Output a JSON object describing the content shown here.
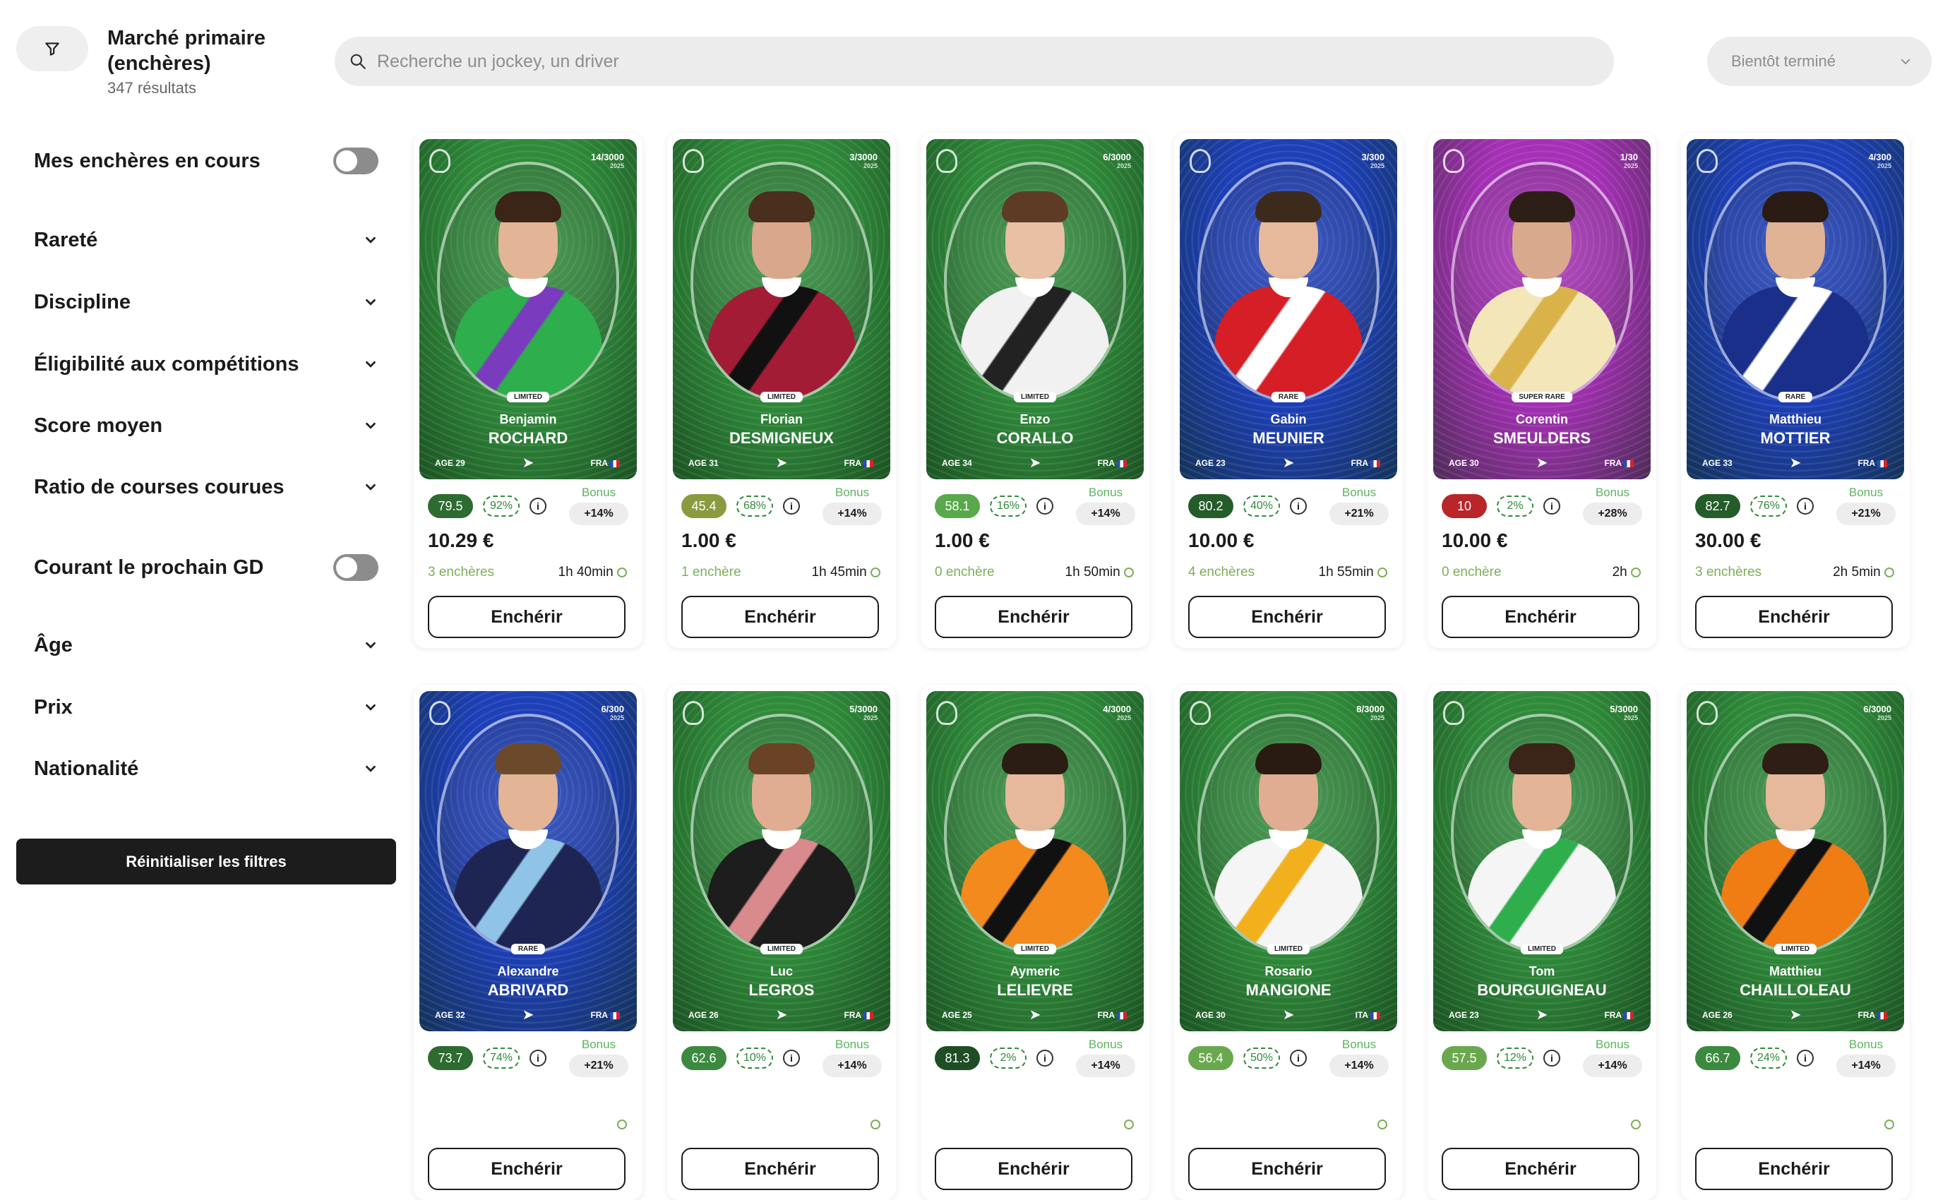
{
  "header": {
    "title": "Marché primaire (enchères)",
    "count": "347 résultats",
    "search_placeholder": "Recherche un jockey, un driver",
    "sort_label": "Bientôt terminé"
  },
  "sidebar": {
    "filters": [
      {
        "label": "Mes enchères en cours",
        "type": "toggle"
      },
      {
        "label": "Rareté",
        "type": "dropdown"
      },
      {
        "label": "Discipline",
        "type": "dropdown"
      },
      {
        "label": "Éligibilité aux compétitions",
        "type": "dropdown"
      },
      {
        "label": "Score moyen",
        "type": "dropdown"
      },
      {
        "label": "Ratio de courses courues",
        "type": "dropdown"
      },
      {
        "label": "Courant le prochain GD",
        "type": "toggle"
      },
      {
        "label": "Âge",
        "type": "dropdown"
      },
      {
        "label": "Prix",
        "type": "dropdown"
      },
      {
        "label": "Nationalité",
        "type": "dropdown"
      }
    ],
    "reset_label": "Réinitialiser les filtres"
  },
  "bid_button_label": "Enchérir",
  "bonus_label": "Bonus",
  "cards": [
    {
      "first": "Benjamin",
      "last": "ROCHARD",
      "serial": "14/3000",
      "year": "2025",
      "rarity": "LIMITED",
      "age": "AGE 29",
      "nat": "FRA",
      "score": "79.5",
      "pct": "92%",
      "bonus": "+14%",
      "price": "10.29 €",
      "bids": "3 enchères",
      "time": "1h 40min",
      "theme": "#2f8a3a",
      "score_color": "#2e6b31",
      "jersey": "#2fae4d",
      "accent": "#7a3bbf",
      "skin": "#e3b496",
      "hair": "#3b2418"
    },
    {
      "first": "Florian",
      "last": "DESMIGNEUX",
      "serial": "3/3000",
      "year": "2025",
      "rarity": "LIMITED",
      "age": "AGE 31",
      "nat": "FRA",
      "score": "45.4",
      "pct": "68%",
      "bonus": "+14%",
      "price": "1.00 €",
      "bids": "1 enchère",
      "time": "1h 45min",
      "theme": "#2f8a3a",
      "score_color": "#8a9a3e",
      "jersey": "#a31c36",
      "accent": "#111",
      "skin": "#d9a88c",
      "hair": "#4a2e1e"
    },
    {
      "first": "Enzo",
      "last": "CORALLO",
      "serial": "6/3000",
      "year": "2025",
      "rarity": "LIMITED",
      "age": "AGE 34",
      "nat": "FRA",
      "score": "58.1",
      "pct": "16%",
      "bonus": "+14%",
      "price": "1.00 €",
      "bids": "0 enchère",
      "time": "1h 50min",
      "theme": "#2f8a3a",
      "score_color": "#5aa84c",
      "jersey": "#f1f1f1",
      "accent": "#222",
      "skin": "#e8c1a5",
      "hair": "#5e3b24"
    },
    {
      "first": "Gabin",
      "last": "MEUNIER",
      "serial": "3/300",
      "year": "2025",
      "rarity": "RARE",
      "age": "AGE 23",
      "nat": "FRA",
      "score": "80.2",
      "pct": "40%",
      "bonus": "+21%",
      "price": "10.00 €",
      "bids": "4 enchères",
      "time": "1h 55min",
      "theme": "#1d3fb8",
      "score_color": "#245c2a",
      "jersey": "#d51e25",
      "accent": "#ffffff",
      "skin": "#e6b89c",
      "hair": "#3c2a1d"
    },
    {
      "first": "Corentin",
      "last": "SMEULDERS",
      "serial": "1/30",
      "year": "2025",
      "rarity": "SUPER RARE",
      "age": "AGE 30",
      "nat": "FRA",
      "score": "10",
      "pct": "2%",
      "bonus": "+28%",
      "price": "10.00 €",
      "bids": "0 enchère",
      "time": "2h",
      "theme": "#a52fb5",
      "score_color": "#b8262a",
      "jersey": "#f3e6b8",
      "accent": "#d9b24a",
      "skin": "#d8a98c",
      "hair": "#2d1f17"
    },
    {
      "first": "Matthieu",
      "last": "MOTTIER",
      "serial": "4/300",
      "year": "2025",
      "rarity": "RARE",
      "age": "AGE 33",
      "nat": "FRA",
      "score": "82.7",
      "pct": "76%",
      "bonus": "+21%",
      "price": "30.00 €",
      "bids": "3 enchères",
      "time": "2h 5min",
      "theme": "#1d3fb8",
      "score_color": "#245c2a",
      "jersey": "#1a2f8a",
      "accent": "#ffffff",
      "skin": "#e0b296",
      "hair": "#2a1c14"
    },
    {
      "first": "Alexandre",
      "last": "ABRIVARD",
      "serial": "6/300",
      "year": "2025",
      "rarity": "RARE",
      "age": "AGE 32",
      "nat": "FRA",
      "score": "73.7",
      "pct": "74%",
      "bonus": "+21%",
      "price": "",
      "bids": "",
      "time": "",
      "theme": "#1d3fb8",
      "score_color": "#2e6b31",
      "jersey": "#1e2552",
      "accent": "#8fc4e8",
      "skin": "#e3b496",
      "hair": "#6b4a2c"
    },
    {
      "first": "Luc",
      "last": "LEGROS",
      "serial": "5/3000",
      "year": "2025",
      "rarity": "LIMITED",
      "age": "AGE 26",
      "nat": "FRA",
      "score": "62.6",
      "pct": "10%",
      "bonus": "+14%",
      "price": "",
      "bids": "",
      "time": "",
      "theme": "#2f8a3a",
      "score_color": "#3c8a40",
      "jersey": "#1d1d1d",
      "accent": "#d88a8c",
      "skin": "#e0ad92",
      "hair": "#6a4226"
    },
    {
      "first": "Aymeric",
      "last": "LELIEVRE",
      "serial": "4/3000",
      "year": "2025",
      "rarity": "LIMITED",
      "age": "AGE 25",
      "nat": "FRA",
      "score": "81.3",
      "pct": "2%",
      "bonus": "+14%",
      "price": "",
      "bids": "",
      "time": "",
      "theme": "#2f8a3a",
      "score_color": "#1f4d24",
      "jersey": "#f28a1d",
      "accent": "#111",
      "skin": "#e6b89c",
      "hair": "#2b1d14"
    },
    {
      "first": "Rosario",
      "last": "MANGIONE",
      "serial": "8/3000",
      "year": "2025",
      "rarity": "LIMITED",
      "age": "AGE 30",
      "nat": "ITA",
      "score": "56.4",
      "pct": "50%",
      "bonus": "+14%",
      "price": "",
      "bids": "",
      "time": "",
      "theme": "#2f8a3a",
      "score_color": "#6aa84f",
      "jersey": "#f5f5f5",
      "accent": "#f2b01d",
      "skin": "#e0ad92",
      "hair": "#2a1b12"
    },
    {
      "first": "Tom",
      "last": "BOURGUIGNEAU",
      "serial": "5/3000",
      "year": "2025",
      "rarity": "LIMITED",
      "age": "AGE 23",
      "nat": "FRA",
      "score": "57.5",
      "pct": "12%",
      "bonus": "+14%",
      "price": "",
      "bids": "",
      "time": "",
      "theme": "#2f8a3a",
      "score_color": "#6aa84f",
      "jersey": "#f5f5f5",
      "accent": "#2fae4d",
      "skin": "#e3b496",
      "hair": "#3b2418"
    },
    {
      "first": "Matthieu",
      "last": "CHAILLOLEAU",
      "serial": "6/3000",
      "year": "2025",
      "rarity": "LIMITED",
      "age": "AGE 26",
      "nat": "FRA",
      "score": "66.7",
      "pct": "24%",
      "bonus": "+14%",
      "price": "",
      "bids": "",
      "time": "",
      "theme": "#2f8a3a",
      "score_color": "#3c8a40",
      "jersey": "#f07d14",
      "accent": "#111",
      "skin": "#e6b89c",
      "hair": "#2f1e15"
    }
  ]
}
